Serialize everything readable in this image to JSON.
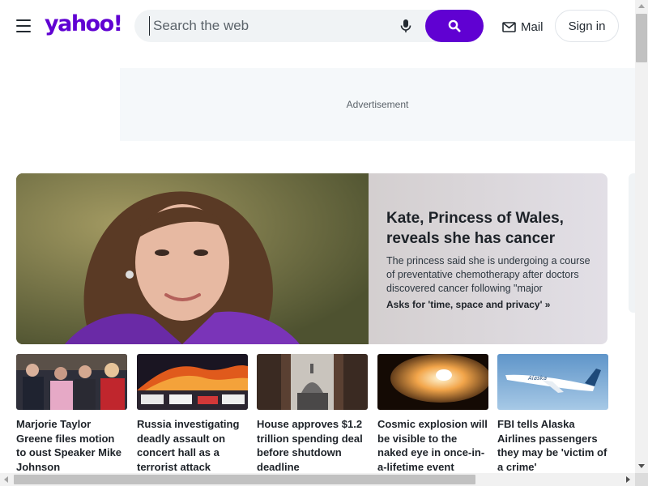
{
  "header": {
    "logo_text": "yahoo!",
    "search": {
      "placeholder": "Search the web",
      "value": ""
    },
    "mail_label": "Mail",
    "signin_label": "Sign in",
    "brand_color": "#6001d2"
  },
  "ad": {
    "label": "Advertisement"
  },
  "hero": {
    "title": "Kate, Princess of Wales, reveals she has cancer",
    "description": "The princess said she is undergoing a course of preventative chemotherapy after doctors discovered cancer following \"major abdomin…",
    "link": "Asks for 'time, space and privacy' »"
  },
  "cards": [
    {
      "title": "Marjorie Taylor Greene files motion to oust Speaker Mike Johnson",
      "image_icon": "political-meeting-photo"
    },
    {
      "title": "Russia investigating deadly assault on concert hall as a terrorist attack",
      "image_icon": "burning-building-photo"
    },
    {
      "title": "House approves $1.2 trillion spending deal before shutdown deadline",
      "image_icon": "capitol-dome-photo"
    },
    {
      "title": "Cosmic explosion will be visible to the naked eye in once-in-a-lifetime event",
      "image_icon": "nova-star-photo"
    },
    {
      "title": "FBI tells Alaska Airlines passengers they may be 'victim of a crime'",
      "image_icon": "airplane-photo"
    }
  ]
}
